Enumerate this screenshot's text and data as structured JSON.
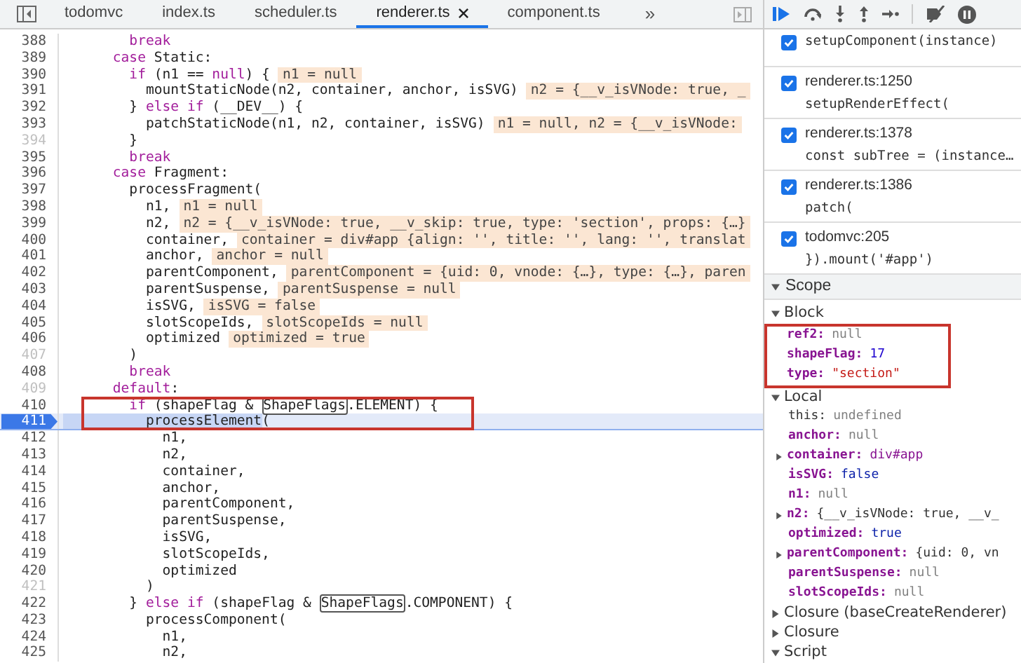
{
  "tabs": [
    {
      "label": "todomvc",
      "selected": false,
      "closable": false
    },
    {
      "label": "index.ts",
      "selected": false,
      "closable": false
    },
    {
      "label": "scheduler.ts",
      "selected": false,
      "closable": false
    },
    {
      "label": "renderer.ts",
      "selected": true,
      "closable": true
    },
    {
      "label": "component.ts",
      "selected": false,
      "closable": false
    }
  ],
  "more_tabs": "»",
  "code_lines": [
    {
      "number": "388",
      "dimmed": false,
      "current": false,
      "outlined": false,
      "tokens": [
        {
          "kind": "keyword",
          "text": "        break"
        }
      ]
    },
    {
      "number": "389",
      "dimmed": false,
      "current": false,
      "outlined": false,
      "tokens": [
        {
          "kind": "keyword",
          "text": "      case"
        },
        {
          "kind": "plain",
          "text": " Static:"
        }
      ]
    },
    {
      "number": "390",
      "dimmed": false,
      "current": false,
      "outlined": false,
      "tokens": [
        {
          "kind": "keyword",
          "text": "        if"
        },
        {
          "kind": "plain",
          "text": " (n1 == "
        },
        {
          "kind": "keyword",
          "text": "null"
        },
        {
          "kind": "plain",
          "text": ") {"
        }
      ],
      "inline_value": "n1 = null"
    },
    {
      "number": "391",
      "dimmed": false,
      "current": false,
      "outlined": false,
      "tokens": [
        {
          "kind": "plain",
          "text": "          mountStaticNode(n2, container, anchor, isSVG)"
        }
      ],
      "inline_value": "n2 = {__v_isVNode: true, _"
    },
    {
      "number": "392",
      "dimmed": false,
      "current": false,
      "outlined": false,
      "tokens": [
        {
          "kind": "plain",
          "text": "        } "
        },
        {
          "kind": "keyword",
          "text": "else if"
        },
        {
          "kind": "plain",
          "text": " (__DEV__) {"
        }
      ]
    },
    {
      "number": "393",
      "dimmed": false,
      "current": false,
      "outlined": false,
      "tokens": [
        {
          "kind": "plain",
          "text": "          patchStaticNode(n1, n2, container, isSVG)"
        }
      ],
      "inline_value": "n1 = null, n2 = {__v_isVNode:"
    },
    {
      "number": "394",
      "dimmed": true,
      "current": false,
      "outlined": false,
      "tokens": [
        {
          "kind": "plain",
          "text": "        }"
        }
      ]
    },
    {
      "number": "395",
      "dimmed": false,
      "current": false,
      "outlined": false,
      "tokens": [
        {
          "kind": "keyword",
          "text": "        break"
        }
      ]
    },
    {
      "number": "396",
      "dimmed": false,
      "current": false,
      "outlined": false,
      "tokens": [
        {
          "kind": "keyword",
          "text": "      case"
        },
        {
          "kind": "plain",
          "text": " Fragment:"
        }
      ]
    },
    {
      "number": "397",
      "dimmed": false,
      "current": false,
      "outlined": false,
      "tokens": [
        {
          "kind": "plain",
          "text": "        processFragment("
        }
      ]
    },
    {
      "number": "398",
      "dimmed": false,
      "current": false,
      "outlined": false,
      "tokens": [
        {
          "kind": "plain",
          "text": "          n1,"
        }
      ],
      "inline_value": "n1 = null"
    },
    {
      "number": "399",
      "dimmed": false,
      "current": false,
      "outlined": false,
      "tokens": [
        {
          "kind": "plain",
          "text": "          n2,"
        }
      ],
      "inline_value": "n2 = {__v_isVNode: true, __v_skip: true, type: 'section', props: {…}"
    },
    {
      "number": "400",
      "dimmed": false,
      "current": false,
      "outlined": false,
      "tokens": [
        {
          "kind": "plain",
          "text": "          container,"
        }
      ],
      "inline_value": "container = div#app {align: '', title: '', lang: '', translat"
    },
    {
      "number": "401",
      "dimmed": false,
      "current": false,
      "outlined": false,
      "tokens": [
        {
          "kind": "plain",
          "text": "          anchor,"
        }
      ],
      "inline_value": "anchor = null"
    },
    {
      "number": "402",
      "dimmed": false,
      "current": false,
      "outlined": false,
      "tokens": [
        {
          "kind": "plain",
          "text": "          parentComponent,"
        }
      ],
      "inline_value": "parentComponent = {uid: 0, vnode: {…}, type: {…}, paren"
    },
    {
      "number": "403",
      "dimmed": false,
      "current": false,
      "outlined": false,
      "tokens": [
        {
          "kind": "plain",
          "text": "          parentSuspense,"
        }
      ],
      "inline_value": "parentSuspense = null"
    },
    {
      "number": "404",
      "dimmed": false,
      "current": false,
      "outlined": false,
      "tokens": [
        {
          "kind": "plain",
          "text": "          isSVG,"
        }
      ],
      "inline_value": "isSVG = false"
    },
    {
      "number": "405",
      "dimmed": false,
      "current": false,
      "outlined": false,
      "tokens": [
        {
          "kind": "plain",
          "text": "          slotScopeIds,"
        }
      ],
      "inline_value": "slotScopeIds = null"
    },
    {
      "number": "406",
      "dimmed": false,
      "current": false,
      "outlined": false,
      "tokens": [
        {
          "kind": "plain",
          "text": "          optimized"
        }
      ],
      "inline_value": "optimized = true"
    },
    {
      "number": "407",
      "dimmed": true,
      "current": false,
      "outlined": false,
      "tokens": [
        {
          "kind": "plain",
          "text": "        )"
        }
      ]
    },
    {
      "number": "408",
      "dimmed": false,
      "current": false,
      "outlined": false,
      "tokens": [
        {
          "kind": "keyword",
          "text": "        break"
        }
      ]
    },
    {
      "number": "409",
      "dimmed": true,
      "current": false,
      "outlined": false,
      "tokens": [
        {
          "kind": "keyword",
          "text": "      default"
        },
        {
          "kind": "plain",
          "text": ":"
        }
      ]
    },
    {
      "number": "410",
      "dimmed": false,
      "current": false,
      "outlined": true,
      "tokens": [
        {
          "kind": "keyword",
          "text": "        if"
        },
        {
          "kind": "plain",
          "text": " (shapeFlag & "
        },
        {
          "kind": "boxed",
          "text": "ShapeFlags"
        },
        {
          "kind": "plain",
          "text": ".ELEMENT) {"
        }
      ]
    },
    {
      "number": "411",
      "dimmed": false,
      "current": true,
      "outlined": true,
      "tokens": [
        {
          "kind": "selected",
          "text": "          processElement"
        },
        {
          "kind": "plain",
          "text": "("
        }
      ]
    },
    {
      "number": "412",
      "dimmed": false,
      "current": false,
      "outlined": false,
      "tokens": [
        {
          "kind": "plain",
          "text": "            n1,"
        }
      ]
    },
    {
      "number": "413",
      "dimmed": false,
      "current": false,
      "outlined": false,
      "tokens": [
        {
          "kind": "plain",
          "text": "            n2,"
        }
      ]
    },
    {
      "number": "414",
      "dimmed": false,
      "current": false,
      "outlined": false,
      "tokens": [
        {
          "kind": "plain",
          "text": "            container,"
        }
      ]
    },
    {
      "number": "415",
      "dimmed": false,
      "current": false,
      "outlined": false,
      "tokens": [
        {
          "kind": "plain",
          "text": "            anchor,"
        }
      ]
    },
    {
      "number": "416",
      "dimmed": false,
      "current": false,
      "outlined": false,
      "tokens": [
        {
          "kind": "plain",
          "text": "            parentComponent,"
        }
      ]
    },
    {
      "number": "417",
      "dimmed": false,
      "current": false,
      "outlined": false,
      "tokens": [
        {
          "kind": "plain",
          "text": "            parentSuspense,"
        }
      ]
    },
    {
      "number": "418",
      "dimmed": false,
      "current": false,
      "outlined": false,
      "tokens": [
        {
          "kind": "plain",
          "text": "            isSVG,"
        }
      ]
    },
    {
      "number": "419",
      "dimmed": false,
      "current": false,
      "outlined": false,
      "tokens": [
        {
          "kind": "plain",
          "text": "            slotScopeIds,"
        }
      ]
    },
    {
      "number": "420",
      "dimmed": false,
      "current": false,
      "outlined": false,
      "tokens": [
        {
          "kind": "plain",
          "text": "            optimized"
        }
      ]
    },
    {
      "number": "421",
      "dimmed": true,
      "current": false,
      "outlined": false,
      "tokens": [
        {
          "kind": "plain",
          "text": "          )"
        }
      ]
    },
    {
      "number": "422",
      "dimmed": false,
      "current": false,
      "outlined": false,
      "tokens": [
        {
          "kind": "plain",
          "text": "        } "
        },
        {
          "kind": "keyword",
          "text": "else if"
        },
        {
          "kind": "plain",
          "text": " (shapeFlag & "
        },
        {
          "kind": "boxed",
          "text": "ShapeFlags"
        },
        {
          "kind": "plain",
          "text": ".COMPONENT) {"
        }
      ]
    },
    {
      "number": "423",
      "dimmed": false,
      "current": false,
      "outlined": false,
      "tokens": [
        {
          "kind": "plain",
          "text": "          processComponent("
        }
      ]
    },
    {
      "number": "424",
      "dimmed": false,
      "current": false,
      "outlined": false,
      "tokens": [
        {
          "kind": "plain",
          "text": "            n1,"
        }
      ]
    },
    {
      "number": "425",
      "dimmed": false,
      "current": false,
      "outlined": false,
      "tokens": [
        {
          "kind": "plain",
          "text": "            n2,"
        }
      ]
    }
  ],
  "call_stack": [
    {
      "checked": true,
      "code": "setupComponent(instance)"
    },
    {
      "checked": true,
      "location": "renderer.ts:1250",
      "code": "setupRenderEffect("
    },
    {
      "checked": true,
      "location": "renderer.ts:1378",
      "code": "const subTree = (instance…"
    },
    {
      "checked": true,
      "location": "renderer.ts:1386",
      "code": "patch("
    },
    {
      "checked": true,
      "location": "todomvc:205",
      "code": "}).mount('#app')"
    }
  ],
  "scope": {
    "title": "Scope",
    "expanded": true,
    "sections": [
      {
        "label": "Block",
        "expanded": true,
        "outlined": true,
        "variables": [
          {
            "name": "ref2:",
            "value": "null",
            "kind": "null",
            "emphasized": true,
            "expandable": false
          },
          {
            "name": "shapeFlag:",
            "value": "17",
            "kind": "number",
            "emphasized": true,
            "expandable": false
          },
          {
            "name": "type:",
            "value": "\"section\"",
            "kind": "string",
            "emphasized": true,
            "expandable": false
          }
        ]
      },
      {
        "label": "Local",
        "expanded": true,
        "variables": [
          {
            "name": "this:",
            "value": "undefined",
            "kind": "null",
            "emphasized": false,
            "expandable": false
          },
          {
            "name": "anchor:",
            "value": "null",
            "kind": "null",
            "emphasized": true,
            "expandable": false
          },
          {
            "name": "container:",
            "value": "div#app",
            "kind": "node",
            "emphasized": true,
            "expandable": true
          },
          {
            "name": "isSVG:",
            "value": "false",
            "kind": "boolean",
            "emphasized": true,
            "expandable": false
          },
          {
            "name": "n1:",
            "value": "null",
            "kind": "null",
            "emphasized": true,
            "expandable": false
          },
          {
            "name": "n2:",
            "value": "{__v_isVNode: true, __v_",
            "kind": "object",
            "emphasized": true,
            "expandable": true
          },
          {
            "name": "optimized:",
            "value": "true",
            "kind": "boolean",
            "emphasized": true,
            "expandable": false
          },
          {
            "name": "parentComponent:",
            "value": "{uid: 0, vn",
            "kind": "object",
            "emphasized": true,
            "expandable": true
          },
          {
            "name": "parentSuspense:",
            "value": "null",
            "kind": "null",
            "emphasized": true,
            "expandable": false
          },
          {
            "name": "slotScopeIds:",
            "value": "null",
            "kind": "null",
            "emphasized": true,
            "expandable": false
          }
        ]
      },
      {
        "label": "Closure (baseCreateRenderer)",
        "expanded": false
      },
      {
        "label": "Closure",
        "expanded": false
      },
      {
        "label": "Script",
        "expanded": true
      }
    ]
  }
}
